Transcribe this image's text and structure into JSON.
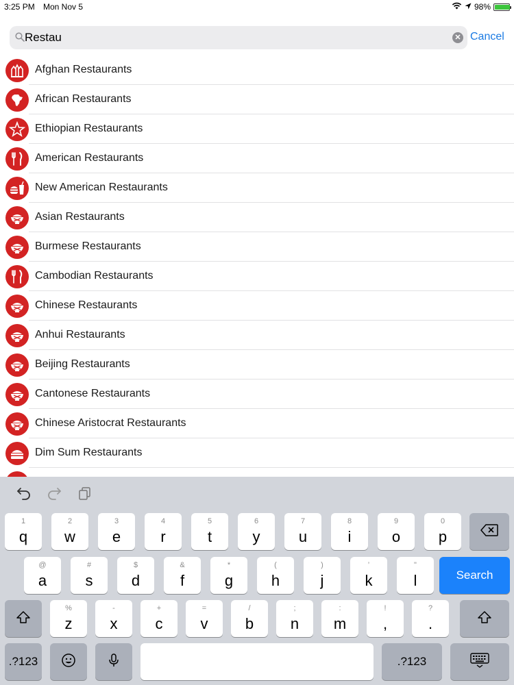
{
  "status_bar": {
    "time": "3:25 PM",
    "date": "Mon Nov 5",
    "battery": "98%",
    "battery_level": 0.98
  },
  "search": {
    "value": "Restau",
    "placeholder": "Search",
    "cancel_label": "Cancel"
  },
  "results": [
    {
      "label": "Afghan Restaurants",
      "icon": "building-icon"
    },
    {
      "label": "African Restaurants",
      "icon": "africa-map-icon"
    },
    {
      "label": "Ethiopian Restaurants",
      "icon": "star-icon"
    },
    {
      "label": "American Restaurants",
      "icon": "fork-knife-icon"
    },
    {
      "label": "New American Restaurants",
      "icon": "burger-drink-icon"
    },
    {
      "label": "Asian Restaurants",
      "icon": "rice-bowl-icon"
    },
    {
      "label": "Burmese Restaurants",
      "icon": "rice-bowl-icon"
    },
    {
      "label": "Cambodian Restaurants",
      "icon": "fork-knife-icon"
    },
    {
      "label": "Chinese Restaurants",
      "icon": "rice-bowl-icon"
    },
    {
      "label": "Anhui Restaurants",
      "icon": "rice-bowl-icon"
    },
    {
      "label": "Beijing Restaurants",
      "icon": "rice-bowl-icon"
    },
    {
      "label": "Cantonese Restaurants",
      "icon": "rice-bowl-icon"
    },
    {
      "label": "Chinese Aristocrat Restaurants",
      "icon": "rice-bowl-icon"
    },
    {
      "label": "Dim Sum Restaurants",
      "icon": "dim-sum-icon"
    },
    {
      "label": "",
      "icon": "rice-bowl-icon"
    }
  ],
  "keyboard": {
    "row1": [
      {
        "main": "q",
        "sub": "1"
      },
      {
        "main": "w",
        "sub": "2"
      },
      {
        "main": "e",
        "sub": "3"
      },
      {
        "main": "r",
        "sub": "4"
      },
      {
        "main": "t",
        "sub": "5"
      },
      {
        "main": "y",
        "sub": "6"
      },
      {
        "main": "u",
        "sub": "7"
      },
      {
        "main": "i",
        "sub": "8"
      },
      {
        "main": "o",
        "sub": "9"
      },
      {
        "main": "p",
        "sub": "0"
      }
    ],
    "row2": [
      {
        "main": "a",
        "sub": "@"
      },
      {
        "main": "s",
        "sub": "#"
      },
      {
        "main": "d",
        "sub": "$"
      },
      {
        "main": "f",
        "sub": "&"
      },
      {
        "main": "g",
        "sub": "*"
      },
      {
        "main": "h",
        "sub": "("
      },
      {
        "main": "j",
        "sub": ")"
      },
      {
        "main": "k",
        "sub": "’"
      },
      {
        "main": "l",
        "sub": "\""
      }
    ],
    "row3": [
      {
        "main": "z",
        "sub": "%"
      },
      {
        "main": "x",
        "sub": "-"
      },
      {
        "main": "c",
        "sub": "+"
      },
      {
        "main": "v",
        "sub": "="
      },
      {
        "main": "b",
        "sub": "/"
      },
      {
        "main": "n",
        "sub": ";"
      },
      {
        "main": "m",
        "sub": ":"
      },
      {
        "main": ",",
        "sub": "!"
      },
      {
        "main": ".",
        "sub": "?"
      }
    ],
    "search_label": "Search",
    "numbers_label": ".?123",
    "accent_color": "#1b82fb"
  }
}
